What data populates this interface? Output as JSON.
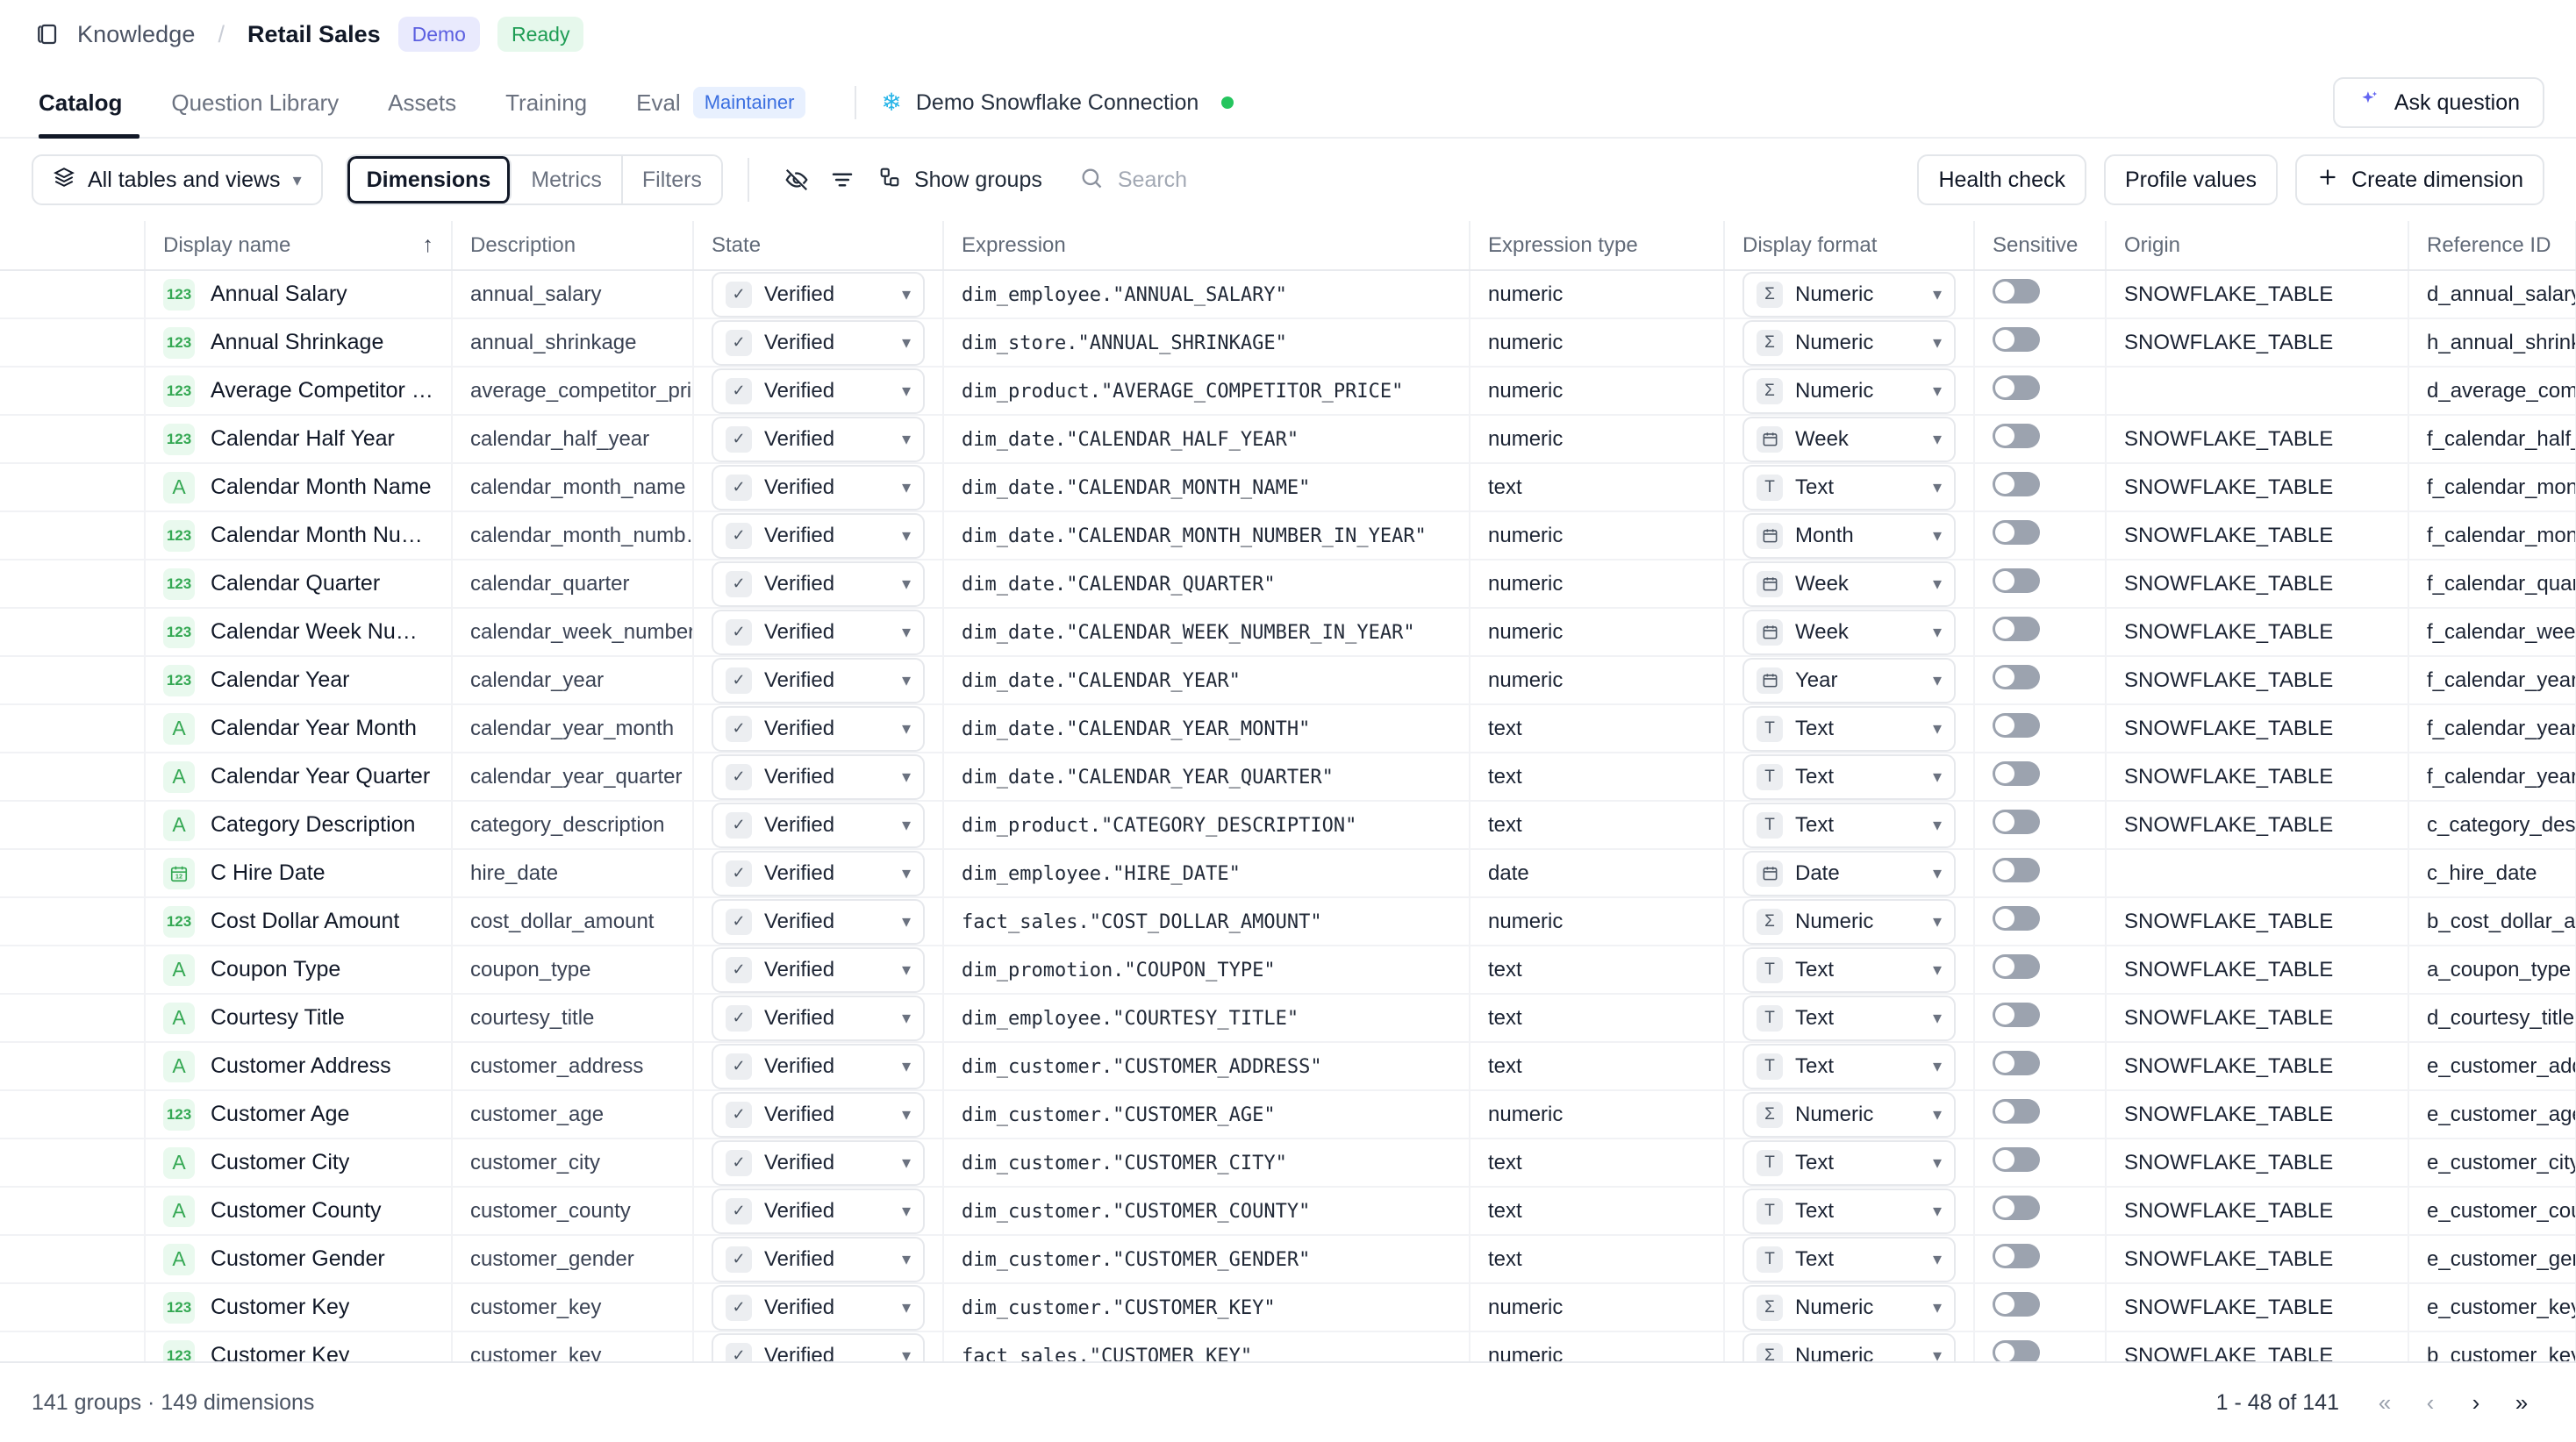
{
  "breadcrumb": {
    "icon": "knowledge-icon",
    "root": "Knowledge",
    "separator": "/",
    "current": "Retail Sales",
    "badges": [
      {
        "label": "Demo",
        "color": "#5b5fe0"
      },
      {
        "label": "Ready",
        "color": "#1f9d55"
      }
    ]
  },
  "tabs": [
    {
      "label": "Catalog",
      "active": true
    },
    {
      "label": "Question Library",
      "active": false
    },
    {
      "label": "Assets",
      "active": false
    },
    {
      "label": "Training",
      "active": false
    },
    {
      "label": "Eval",
      "active": false,
      "pill": "Maintainer"
    }
  ],
  "connection": {
    "icon": "snowflake-icon",
    "name": "Demo Snowflake Connection",
    "status_color": "#25c55e"
  },
  "ask_button": {
    "label": "Ask question",
    "icon": "sparkle-icon"
  },
  "toolbar": {
    "scope_selector": "All tables and views",
    "segments": [
      {
        "label": "Dimensions",
        "active": true
      },
      {
        "label": "Metrics",
        "active": false
      },
      {
        "label": "Filters",
        "active": false
      }
    ],
    "hide_icon": "eye-off-icon",
    "filter_icon": "filter-icon",
    "show_groups": "Show groups",
    "show_groups_icon": "groups-icon",
    "search_placeholder": "Search",
    "search_value": "",
    "health_check": "Health check",
    "profile_values": "Profile values",
    "create_dimension": "Create dimension"
  },
  "table": {
    "columns": [
      "Display name",
      "Description",
      "State",
      "Expression",
      "Expression type",
      "Display format",
      "Sensitive",
      "Origin",
      "Reference ID"
    ],
    "sort_column": "Display name",
    "sort_direction": "asc",
    "rows": [
      {
        "type": "123",
        "name": "Annual Salary",
        "description": "annual_salary",
        "state": "Verified",
        "expression": "dim_employee.\"ANNUAL_SALARY\"",
        "expression_type": "numeric",
        "display_format": "Numeric",
        "format_icon": "sigma",
        "sensitive": false,
        "origin": "SNOWFLAKE_TABLE",
        "reference_id": "d_annual_salary"
      },
      {
        "type": "123",
        "name": "Annual Shrinkage",
        "description": "annual_shrinkage",
        "state": "Verified",
        "expression": "dim_store.\"ANNUAL_SHRINKAGE\"",
        "expression_type": "numeric",
        "display_format": "Numeric",
        "format_icon": "sigma",
        "sensitive": false,
        "origin": "SNOWFLAKE_TABLE",
        "reference_id": "h_annual_shrinkage"
      },
      {
        "type": "123",
        "name": "Average Competitor Pri…",
        "description": "average_competitor_pri…",
        "state": "Verified",
        "expression": "dim_product.\"AVERAGE_COMPETITOR_PRICE\"",
        "expression_type": "numeric",
        "display_format": "Numeric",
        "format_icon": "sigma",
        "sensitive": false,
        "origin": "",
        "reference_id": "d_average_compe"
      },
      {
        "type": "123",
        "name": "Calendar Half Year",
        "description": "calendar_half_year",
        "state": "Verified",
        "expression": "dim_date.\"CALENDAR_HALF_YEAR\"",
        "expression_type": "numeric",
        "display_format": "Week",
        "format_icon": "calendar",
        "sensitive": false,
        "origin": "SNOWFLAKE_TABLE",
        "reference_id": "f_calendar_half_ye"
      },
      {
        "type": "A",
        "name": "Calendar Month Name",
        "description": "calendar_month_name",
        "state": "Verified",
        "expression": "dim_date.\"CALENDAR_MONTH_NAME\"",
        "expression_type": "text",
        "display_format": "Text",
        "format_icon": "text",
        "sensitive": false,
        "origin": "SNOWFLAKE_TABLE",
        "reference_id": "f_calendar_month"
      },
      {
        "type": "123",
        "name": "Calendar Month Numb…",
        "description": "calendar_month_numb…",
        "state": "Verified",
        "expression": "dim_date.\"CALENDAR_MONTH_NUMBER_IN_YEAR\"",
        "expression_type": "numeric",
        "display_format": "Month",
        "format_icon": "calendar",
        "sensitive": false,
        "origin": "SNOWFLAKE_TABLE",
        "reference_id": "f_calendar_month"
      },
      {
        "type": "123",
        "name": "Calendar Quarter",
        "description": "calendar_quarter",
        "state": "Verified",
        "expression": "dim_date.\"CALENDAR_QUARTER\"",
        "expression_type": "numeric",
        "display_format": "Week",
        "format_icon": "calendar",
        "sensitive": false,
        "origin": "SNOWFLAKE_TABLE",
        "reference_id": "f_calendar_quarte"
      },
      {
        "type": "123",
        "name": "Calendar Week Numbe…",
        "description": "calendar_week_number…",
        "state": "Verified",
        "expression": "dim_date.\"CALENDAR_WEEK_NUMBER_IN_YEAR\"",
        "expression_type": "numeric",
        "display_format": "Week",
        "format_icon": "calendar",
        "sensitive": false,
        "origin": "SNOWFLAKE_TABLE",
        "reference_id": "f_calendar_week_"
      },
      {
        "type": "123",
        "name": "Calendar Year",
        "description": "calendar_year",
        "state": "Verified",
        "expression": "dim_date.\"CALENDAR_YEAR\"",
        "expression_type": "numeric",
        "display_format": "Year",
        "format_icon": "calendar",
        "sensitive": false,
        "origin": "SNOWFLAKE_TABLE",
        "reference_id": "f_calendar_year"
      },
      {
        "type": "A",
        "name": "Calendar Year Month",
        "description": "calendar_year_month",
        "state": "Verified",
        "expression": "dim_date.\"CALENDAR_YEAR_MONTH\"",
        "expression_type": "text",
        "display_format": "Text",
        "format_icon": "text",
        "sensitive": false,
        "origin": "SNOWFLAKE_TABLE",
        "reference_id": "f_calendar_year_n"
      },
      {
        "type": "A",
        "name": "Calendar Year Quarter",
        "description": "calendar_year_quarter",
        "state": "Verified",
        "expression": "dim_date.\"CALENDAR_YEAR_QUARTER\"",
        "expression_type": "text",
        "display_format": "Text",
        "format_icon": "text",
        "sensitive": false,
        "origin": "SNOWFLAKE_TABLE",
        "reference_id": "f_calendar_year_q"
      },
      {
        "type": "A",
        "name": "Category Description",
        "description": "category_description",
        "state": "Verified",
        "expression": "dim_product.\"CATEGORY_DESCRIPTION\"",
        "expression_type": "text",
        "display_format": "Text",
        "format_icon": "text",
        "sensitive": false,
        "origin": "SNOWFLAKE_TABLE",
        "reference_id": "c_category_descr"
      },
      {
        "type": "date",
        "name": "C Hire Date",
        "description": "hire_date",
        "state": "Verified",
        "expression": "dim_employee.\"HIRE_DATE\"",
        "expression_type": "date",
        "display_format": "Date",
        "format_icon": "calendar",
        "sensitive": false,
        "origin": "",
        "reference_id": "c_hire_date"
      },
      {
        "type": "123",
        "name": "Cost Dollar Amount",
        "description": "cost_dollar_amount",
        "state": "Verified",
        "expression": "fact_sales.\"COST_DOLLAR_AMOUNT\"",
        "expression_type": "numeric",
        "display_format": "Numeric",
        "format_icon": "sigma",
        "sensitive": false,
        "origin": "SNOWFLAKE_TABLE",
        "reference_id": "b_cost_dollar_amo"
      },
      {
        "type": "A",
        "name": "Coupon Type",
        "description": "coupon_type",
        "state": "Verified",
        "expression": "dim_promotion.\"COUPON_TYPE\"",
        "expression_type": "text",
        "display_format": "Text",
        "format_icon": "text",
        "sensitive": false,
        "origin": "SNOWFLAKE_TABLE",
        "reference_id": "a_coupon_type"
      },
      {
        "type": "A",
        "name": "Courtesy Title",
        "description": "courtesy_title",
        "state": "Verified",
        "expression": "dim_employee.\"COURTESY_TITLE\"",
        "expression_type": "text",
        "display_format": "Text",
        "format_icon": "text",
        "sensitive": false,
        "origin": "SNOWFLAKE_TABLE",
        "reference_id": "d_courtesy_title"
      },
      {
        "type": "A",
        "name": "Customer Address",
        "description": "customer_address",
        "state": "Verified",
        "expression": "dim_customer.\"CUSTOMER_ADDRESS\"",
        "expression_type": "text",
        "display_format": "Text",
        "format_icon": "text",
        "sensitive": false,
        "origin": "SNOWFLAKE_TABLE",
        "reference_id": "e_customer_addre"
      },
      {
        "type": "123",
        "name": "Customer Age",
        "description": "customer_age",
        "state": "Verified",
        "expression": "dim_customer.\"CUSTOMER_AGE\"",
        "expression_type": "numeric",
        "display_format": "Numeric",
        "format_icon": "sigma",
        "sensitive": false,
        "origin": "SNOWFLAKE_TABLE",
        "reference_id": "e_customer_age"
      },
      {
        "type": "A",
        "name": "Customer City",
        "description": "customer_city",
        "state": "Verified",
        "expression": "dim_customer.\"CUSTOMER_CITY\"",
        "expression_type": "text",
        "display_format": "Text",
        "format_icon": "text",
        "sensitive": false,
        "origin": "SNOWFLAKE_TABLE",
        "reference_id": "e_customer_city"
      },
      {
        "type": "A",
        "name": "Customer County",
        "description": "customer_county",
        "state": "Verified",
        "expression": "dim_customer.\"CUSTOMER_COUNTY\"",
        "expression_type": "text",
        "display_format": "Text",
        "format_icon": "text",
        "sensitive": false,
        "origin": "SNOWFLAKE_TABLE",
        "reference_id": "e_customer_coun"
      },
      {
        "type": "A",
        "name": "Customer Gender",
        "description": "customer_gender",
        "state": "Verified",
        "expression": "dim_customer.\"CUSTOMER_GENDER\"",
        "expression_type": "text",
        "display_format": "Text",
        "format_icon": "text",
        "sensitive": false,
        "origin": "SNOWFLAKE_TABLE",
        "reference_id": "e_customer_gend"
      },
      {
        "type": "123",
        "name": "Customer Key",
        "description": "customer_key",
        "state": "Verified",
        "expression": "dim_customer.\"CUSTOMER_KEY\"",
        "expression_type": "numeric",
        "display_format": "Numeric",
        "format_icon": "sigma",
        "sensitive": false,
        "origin": "SNOWFLAKE_TABLE",
        "reference_id": "e_customer_key"
      },
      {
        "type": "123",
        "name": "Customer Key",
        "description": "customer_key",
        "state": "Verified",
        "expression": "fact_sales.\"CUSTOMER_KEY\"",
        "expression_type": "numeric",
        "display_format": "Numeric",
        "format_icon": "sigma",
        "sensitive": false,
        "origin": "SNOWFLAKE_TABLE",
        "reference_id": "b_customer_key"
      }
    ]
  },
  "footer": {
    "summary": "141 groups  ·  149 dimensions",
    "page_range": "1 - 48 of 141",
    "first_label": "«",
    "prev_label": "‹",
    "next_label": "›",
    "last_label": "»"
  }
}
